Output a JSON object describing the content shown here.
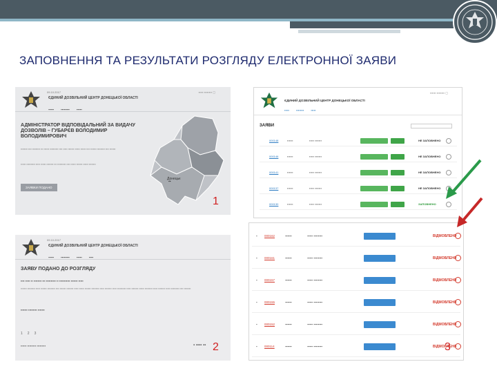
{
  "slide": {
    "title": "ЗАПОВНЕННЯ ТА РЕЗУЛЬТАТИ РОЗГЛЯДУ ЕЛЕКТРОННОЇ ЗАЯВИ",
    "markers": [
      "1",
      "2",
      "3"
    ]
  },
  "panel1": {
    "date": "09.10.2017",
    "site_title": "ЄДИНИЙ ДОЗВІЛЬНИЙ ЦЕНТР ДОНЕЦЬКОЇ ОБЛАСТІ",
    "heading": "АДМІНІСТРАТОР ВІДПОВІДАЛЬНИЙ ЗА ВИДАЧУ ДОЗВОЛІВ – ГУБАРЄВ ВОЛОДИМИР ВОЛОДИМИРОВИЧ",
    "button": "ЗАЯВКИ ПОДАНО",
    "map_labels": [
      "Донецьк"
    ]
  },
  "panel2": {
    "heading": "ЗАЯВУ ПОДАНО ДО РОЗГЛЯДУ",
    "pages": [
      "1",
      "2",
      "3"
    ]
  },
  "panel3": {
    "title": "ЗАЯВИ",
    "rows": [
      {
        "id": "000148",
        "status": "НЕ ЗАПОВНЕНО",
        "status_color": "#333333"
      },
      {
        "id": "000146",
        "status": "НЕ ЗАПОВНЕНО",
        "status_color": "#333333"
      },
      {
        "id": "000141",
        "status": "НЕ ЗАПОВНЕНО",
        "status_color": "#333333"
      },
      {
        "id": "000137",
        "status": "НЕ ЗАПОВНЕНО",
        "status_color": "#333333"
      },
      {
        "id": "000130",
        "status": "ЗАПОВНЕНО",
        "status_color": "#2d9a3a"
      }
    ]
  },
  "panel4": {
    "rows": [
      {
        "id": "000162",
        "status": "ВІДМОВЛЕНО"
      },
      {
        "id": "000161",
        "status": "ВІДМОВЛЕНО"
      },
      {
        "id": "000157",
        "status": "ВІДМОВЛЕНО"
      },
      {
        "id": "000155",
        "status": "ВІДМОВЛЕНО"
      },
      {
        "id": "000152",
        "status": "ВІДМОВЛЕНО"
      },
      {
        "id": "000114",
        "status": "ВІДМОВЛЕНО"
      }
    ]
  },
  "colors": {
    "title": "#1e2a6e",
    "header_bar": "#4b5a63",
    "accent_line": "#8fb7c7",
    "marker": "#d02020",
    "arrow_green": "#2a9a4a",
    "arrow_red": "#c62828"
  }
}
